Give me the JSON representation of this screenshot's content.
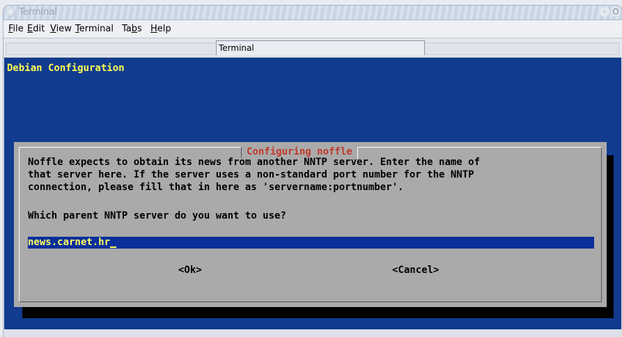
{
  "window": {
    "title": "Terminal",
    "buttons": [
      "·",
      "O"
    ]
  },
  "menubar": {
    "items": [
      {
        "label": "File",
        "mnemonic": "F"
      },
      {
        "label": "Edit",
        "mnemonic": "E"
      },
      {
        "label": "View",
        "mnemonic": "V"
      },
      {
        "label": "Terminal",
        "mnemonic": "T"
      },
      {
        "label": "Tabs",
        "mnemonic": "b"
      },
      {
        "label": "Help",
        "mnemonic": "H"
      }
    ]
  },
  "tabs": [
    {
      "label": "Terminal",
      "active": true
    }
  ],
  "terminal": {
    "header": "Debian Configuration",
    "dialog": {
      "title": "Configuring noffle",
      "description_lines": [
        "Noffle expects to obtain its news from another NNTP server. Enter the name of",
        "that server here. If the server uses a non-standard port number for the NNTP",
        "connection, please fill that in here as 'servername:portnumber'."
      ],
      "question": "Which parent NNTP server do you want to use?",
      "input_value": "news.carnet.hr",
      "ok_label": "<Ok>",
      "cancel_label": "<Cancel>"
    }
  },
  "colors": {
    "terminal_background": "#113b8f",
    "header_text": "#ffff55",
    "dialog_background": "#aaaaaa",
    "dialog_title": "#c0392b",
    "input_background": "#0b2f9a",
    "input_text": "#ffff66"
  }
}
